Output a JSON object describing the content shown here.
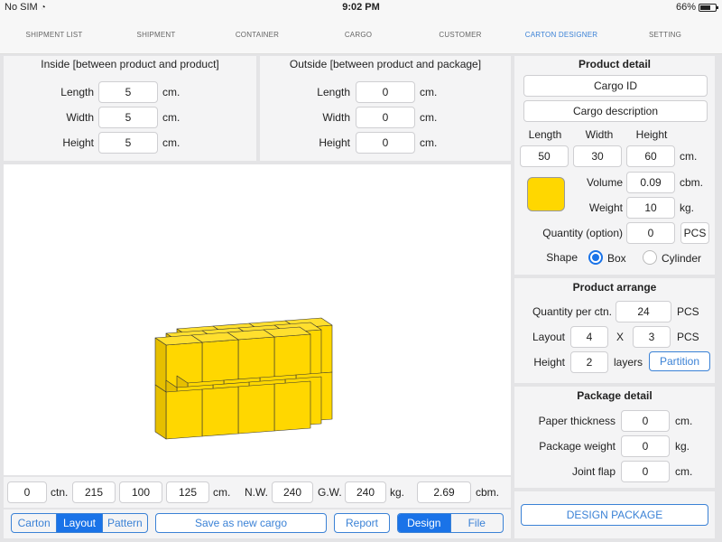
{
  "status": {
    "carrier": "No SIM",
    "time": "9:02 PM",
    "battery": "66%"
  },
  "tabs": [
    "SHIPMENT LIST",
    "SHIPMENT",
    "CONTAINER",
    "CARGO",
    "CUSTOMER",
    "CARTON DESIGNER",
    "SETTING"
  ],
  "active_tab": "CARTON DESIGNER",
  "inside": {
    "title": "Inside [between product and product]",
    "length_label": "Length",
    "length": "5",
    "width_label": "Width",
    "width": "5",
    "height_label": "Height",
    "height": "5",
    "unit": "cm."
  },
  "outside": {
    "title": "Outside [between product and package]",
    "length_label": "Length",
    "length": "0",
    "width_label": "Width",
    "width": "0",
    "height_label": "Height",
    "height": "0",
    "unit": "cm."
  },
  "product_detail": {
    "title": "Product detail",
    "cargo_id": "Cargo ID",
    "cargo_description": "Cargo description",
    "length_label": "Length",
    "width_label": "Width",
    "height_label": "Height",
    "length": "50",
    "width": "30",
    "height": "60",
    "dim_unit": "cm.",
    "color": "#ffd700",
    "volume_label": "Volume",
    "volume": "0.09",
    "volume_unit": "cbm.",
    "weight_label": "Weight",
    "weight": "10",
    "weight_unit": "kg.",
    "quantity_label": "Quantity (option)",
    "quantity": "0",
    "quantity_unit": "PCS",
    "shape_label": "Shape",
    "shape_box": "Box",
    "shape_cylinder": "Cylinder",
    "shape_selected": "Box"
  },
  "product_arrange": {
    "title": "Product arrange",
    "qty_label": "Quantity per ctn.",
    "qty": "24",
    "qty_unit": "PCS",
    "layout_label": "Layout",
    "layout_a": "4",
    "layout_x": "X",
    "layout_b": "3",
    "layout_unit": "PCS",
    "height_label": "Height",
    "height": "2",
    "height_unit": "layers",
    "partition": "Partition"
  },
  "package_detail": {
    "title": "Package detail",
    "paper_label": "Paper thickness",
    "paper": "0",
    "paper_unit": "cm.",
    "weight_label": "Package weight",
    "weight": "0",
    "weight_unit": "kg.",
    "flap_label": "Joint flap",
    "flap": "0",
    "flap_unit": "cm."
  },
  "summary": {
    "ctn": "0",
    "ctn_unit": "ctn.",
    "l": "215",
    "w": "100",
    "h": "125",
    "dim_unit": "cm.",
    "nw_label": "N.W.",
    "nw": "240",
    "gw_label": "G.W.",
    "gw": "240",
    "wt_unit": "kg.",
    "cbm": "2.69",
    "cbm_unit": "cbm."
  },
  "bottom": {
    "view_seg": [
      "Carton",
      "Layout",
      "Pattern"
    ],
    "view_selected": "Layout",
    "save": "Save as new cargo",
    "report": "Report",
    "mode_seg": [
      "Design",
      "File"
    ],
    "mode_selected": "Design",
    "design_package": "DESIGN PACKAGE"
  },
  "colors": {
    "accent": "#1a73e8",
    "box_face": "#ffd700",
    "box_top": "#ffdf2e",
    "box_side": "#e6bf00"
  }
}
